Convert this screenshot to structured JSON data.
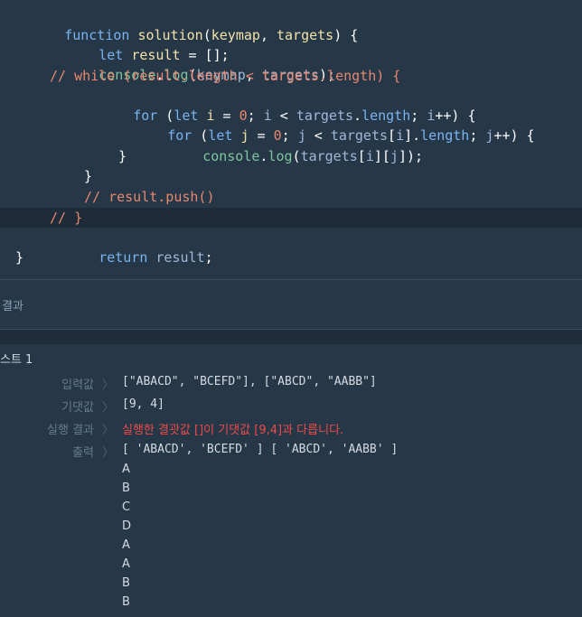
{
  "code": {
    "l1": [
      "function",
      "solution",
      "(",
      "keymap",
      ", ",
      "targets",
      ") {"
    ],
    "l2": [
      "let",
      "result",
      " = [];"
    ],
    "l3": [
      "console",
      ".",
      "log",
      "(",
      "keymap",
      ", ",
      "targets",
      ");"
    ],
    "l4": "// while (result.length < targets.length) {",
    "l5": [
      "for",
      " (",
      "let",
      "i",
      " = ",
      "0",
      "; ",
      "i",
      " < ",
      "targets",
      ".",
      "length",
      "; ",
      "i",
      "++) {"
    ],
    "l6": [
      "for",
      " (",
      "let",
      "j",
      " = ",
      "0",
      "; ",
      "j",
      " < ",
      "targets",
      "[",
      "i",
      "].",
      "length",
      "; ",
      "j",
      "++) {"
    ],
    "l7": [
      "console",
      ".",
      "log",
      "(",
      "targets",
      "[",
      "i",
      "][",
      "j",
      "]);"
    ],
    "l8": "}",
    "l9": "}",
    "l10": "// result.push()",
    "l11": "// }",
    "l12": [
      "return",
      "result",
      ";"
    ],
    "l13": "}"
  },
  "result_panel": {
    "title": "결과",
    "test_title": "스트 1",
    "rows": [
      {
        "label": "입력값",
        "arrow": "〉",
        "value": "[\"ABACD\", \"BCEFD\"], [\"ABCD\", \"AABB\"]"
      },
      {
        "label": "기댓값",
        "arrow": "〉",
        "value": "[9, 4]"
      },
      {
        "label": "실행 결과",
        "arrow": "〉",
        "value": "실행한 결괏값 []이 기댓값 [9,4]과 다릅니다."
      },
      {
        "label": "출력",
        "arrow": "〉",
        "value": "[ 'ABACD', 'BCEFD' ] [ 'ABCD', 'AABB' ]"
      }
    ],
    "output_lines": [
      "A",
      "B",
      "C",
      "D",
      "A",
      "A",
      "B",
      "B"
    ]
  },
  "colors": {
    "background": "#263747",
    "active_line": "#1e2b38",
    "error": "#ef4a4a",
    "comment": "#e7886f"
  }
}
